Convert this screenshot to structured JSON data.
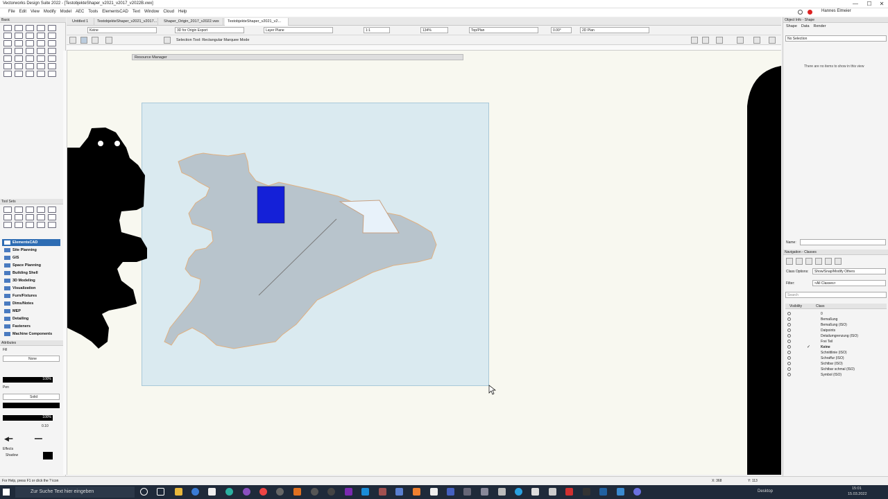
{
  "window": {
    "title": "Vectorworks Design Suite 2022 - [TestobjekteShaper_v2021_v2017_v2022B.vwx]",
    "controls": [
      "—",
      "☐",
      "✕"
    ]
  },
  "menu": [
    "File",
    "Edit",
    "View",
    "Modify",
    "Model",
    "AEC",
    "Tools",
    "ElementsCAD",
    "Text",
    "Window",
    "Cloud",
    "Help"
  ],
  "user": {
    "name": "Hannes Elmeier"
  },
  "tabs": [
    {
      "label": "Untitled 1",
      "active": false
    },
    {
      "label": "TestobjekteShaper_v2021_v2017...",
      "active": false
    },
    {
      "label": "Shaper_Origin_2017_v2022.vwx",
      "active": false
    },
    {
      "label": "TestobjekteShaper_v2021_v2...",
      "active": true
    }
  ],
  "view_bar": {
    "class_field": "Keine",
    "saved_view": "3D for Origin Export",
    "layer": "Layer Plane",
    "scale": "1:1",
    "zoom": "134%",
    "view": "Top/Plan",
    "angle": "0.00°",
    "render": "2D Plan"
  },
  "mode_bar": {
    "text": "Selection Tool: Rectangular Marquee Mode"
  },
  "left_panel": {
    "basic_title": "Basic",
    "toolsets_title": "Tool Sets",
    "toolsets": [
      "ElementsCAD",
      "Site Planning",
      "GIS",
      "Space Planning",
      "Building Shell",
      "3D Modeling",
      "Visualization",
      "Furn/Fixtures",
      "Dims/Notes",
      "MEP",
      "Detailing",
      "Fasteners",
      "Machine Components"
    ],
    "selected_toolset": "ElementsCAD",
    "attributes_title": "Attributes",
    "fill_label": "Fill",
    "fill_value": "None",
    "fill_opacity": "100%",
    "pen_label": "Pen",
    "pen_value": "Solid",
    "pen_opacity": "100%",
    "line_weight": "0.10",
    "shadow_label": "Shadow",
    "effects_label": "Effects"
  },
  "resource_manager": {
    "title": "Resource Manager"
  },
  "right_panel": {
    "oip_title": "Object Info - Shape",
    "oip_tabs": [
      "Shape",
      "Data",
      "Render"
    ],
    "selection_text": "No Selection",
    "empty_message": "There are no items to show in this view",
    "name_label": "Name:",
    "nav_title": "Navigation - Classes",
    "class_options_label": "Class Options:",
    "class_options_value": "Show/Snap/Modify Others",
    "filter_label": "Filter:",
    "filter_value": "<All Classes>",
    "search_placeholder": "Search",
    "col_visibility": "Visibility",
    "col_class": "Class",
    "classes": [
      {
        "name": "0",
        "active": false
      },
      {
        "name": "Bemaßung",
        "active": false
      },
      {
        "name": "Bemaßung (ISO)",
        "active": false
      },
      {
        "name": "Datpoints",
        "active": false
      },
      {
        "name": "Detailumgrenzung (ISO)",
        "active": false
      },
      {
        "name": "Frei Teil",
        "active": false
      },
      {
        "name": "Keine",
        "active": true
      },
      {
        "name": "Schnittlinie (ISO)",
        "active": false
      },
      {
        "name": "Schraffur (ISO)",
        "active": false
      },
      {
        "name": "Sichtbar (ISO)",
        "active": false
      },
      {
        "name": "Sichtbar schmal (ISO)",
        "active": false
      },
      {
        "name": "Symbol (ISO)",
        "active": false
      }
    ]
  },
  "status": {
    "help": "For Help, press F1 or click the ? icon",
    "x": "X: 368",
    "y": "Y: 113"
  },
  "taskbar": {
    "search_placeholder": "Zur Suche Text hier eingeben",
    "desktop": "Desktop",
    "time": "15:01",
    "date": "15.03.2022"
  },
  "colors": {
    "accent": "#2d6cb3",
    "sheet": "#daeaf0",
    "shape": "#b8c4cc",
    "blue_rect": "#1420d8"
  }
}
